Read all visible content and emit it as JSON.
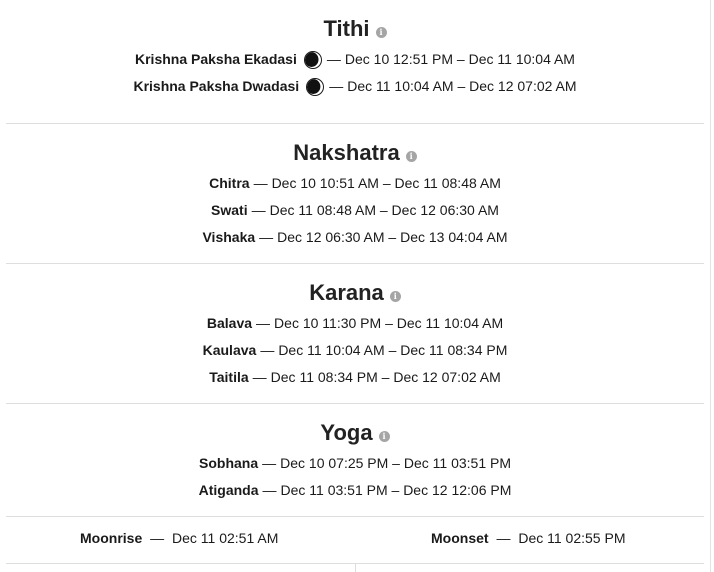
{
  "tithi": {
    "title": "Tithi",
    "rows": [
      {
        "name": "Krishna Paksha Ekadasi",
        "range": "Dec 10 12:51 PM – Dec 11 10:04 AM"
      },
      {
        "name": "Krishna Paksha Dwadasi",
        "range": "Dec 11 10:04 AM – Dec 12 07:02 AM"
      }
    ]
  },
  "nakshatra": {
    "title": "Nakshatra",
    "rows": [
      {
        "name": "Chitra",
        "range": "Dec 10 10:51 AM – Dec 11 08:48 AM"
      },
      {
        "name": "Swati",
        "range": "Dec 11 08:48 AM – Dec 12 06:30 AM"
      },
      {
        "name": "Vishaka",
        "range": "Dec 12 06:30 AM – Dec 13 04:04 AM"
      }
    ]
  },
  "karana": {
    "title": "Karana",
    "rows": [
      {
        "name": "Balava",
        "range": "Dec 10 11:30 PM – Dec 11 10:04 AM"
      },
      {
        "name": "Kaulava",
        "range": "Dec 11 10:04 AM – Dec 11 08:34 PM"
      },
      {
        "name": "Taitila",
        "range": "Dec 11 08:34 PM – Dec 12 07:02 AM"
      }
    ]
  },
  "yoga": {
    "title": "Yoga",
    "rows": [
      {
        "name": "Sobhana",
        "range": "Dec 10 07:25 PM – Dec 11 03:51 PM"
      },
      {
        "name": "Atiganda",
        "range": "Dec 11 03:51 PM – Dec 12 12:06 PM"
      }
    ]
  },
  "moon": {
    "rise_label": "Moonrise",
    "rise_time": "Dec 11 02:51 AM",
    "set_label": "Moonset",
    "set_time": "Dec 11 02:55 PM"
  },
  "dash": "—",
  "info_glyph": "i",
  "icons": {
    "info": "info-icon",
    "moon_phase": "waning-moon-icon"
  }
}
